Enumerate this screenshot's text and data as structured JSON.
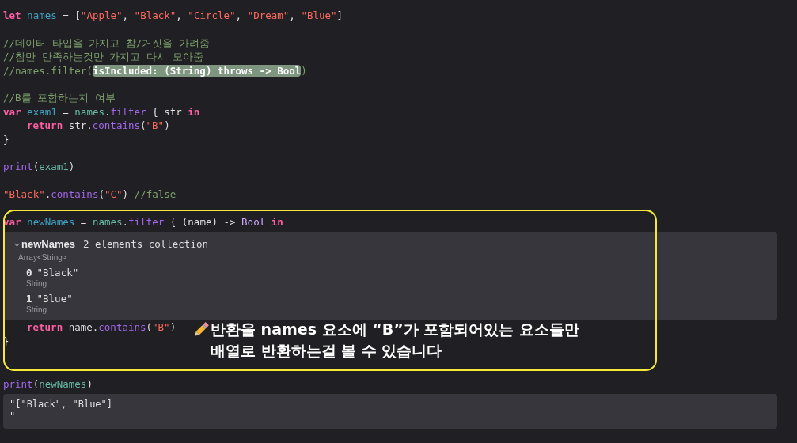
{
  "code_top": [
    {
      "kind": "code",
      "tokens": [
        {
          "kind": "kw",
          "t": "let "
        },
        {
          "kind": "decl",
          "t": "names"
        },
        {
          "kind": "p",
          "t": " = ["
        },
        {
          "kind": "str",
          "t": "\"Apple\""
        },
        {
          "kind": "p",
          "t": ", "
        },
        {
          "kind": "str",
          "t": "\"Black\""
        },
        {
          "kind": "p",
          "t": ", "
        },
        {
          "kind": "str",
          "t": "\"Circle\""
        },
        {
          "kind": "p",
          "t": ", "
        },
        {
          "kind": "str",
          "t": "\"Dream\""
        },
        {
          "kind": "p",
          "t": ", "
        },
        {
          "kind": "str",
          "t": "\"Blue\""
        },
        {
          "kind": "p",
          "t": "]"
        }
      ]
    },
    {
      "kind": "blank"
    },
    {
      "kind": "code",
      "tokens": [
        {
          "kind": "cm",
          "t": "//데이터 타입을 가지고 참/거짓을 가려줌"
        }
      ]
    },
    {
      "kind": "code",
      "tokens": [
        {
          "kind": "cm",
          "t": "//참만 만족하는것만 가지고 다시 모아줌"
        }
      ]
    },
    {
      "kind": "code",
      "tokens": [
        {
          "kind": "cm",
          "t": "//names.filter("
        },
        {
          "kind": "hl",
          "t": "isIncluded: (String) throws -> Bool"
        },
        {
          "kind": "cm",
          "t": ")"
        }
      ]
    },
    {
      "kind": "blank"
    },
    {
      "kind": "code",
      "tokens": [
        {
          "kind": "cm",
          "t": "//B를 포함하는지 여부"
        }
      ]
    },
    {
      "kind": "code",
      "tokens": [
        {
          "kind": "kw",
          "t": "var "
        },
        {
          "kind": "decl",
          "t": "exam1"
        },
        {
          "kind": "p",
          "t": " = "
        },
        {
          "kind": "ref",
          "t": "names"
        },
        {
          "kind": "p",
          "t": "."
        },
        {
          "kind": "fn",
          "t": "filter"
        },
        {
          "kind": "p",
          "t": " { str "
        },
        {
          "kind": "kw",
          "t": "in"
        }
      ]
    },
    {
      "kind": "code",
      "indent": true,
      "tokens": [
        {
          "kind": "kw",
          "t": "return"
        },
        {
          "kind": "p",
          "t": " str."
        },
        {
          "kind": "fn",
          "t": "contains"
        },
        {
          "kind": "p",
          "t": "("
        },
        {
          "kind": "str",
          "t": "\"B\""
        },
        {
          "kind": "p",
          "t": ")"
        }
      ]
    },
    {
      "kind": "code",
      "tokens": [
        {
          "kind": "p",
          "t": "}"
        }
      ]
    },
    {
      "kind": "blank"
    },
    {
      "kind": "code",
      "tokens": [
        {
          "kind": "fn",
          "t": "print"
        },
        {
          "kind": "p",
          "t": "("
        },
        {
          "kind": "ref",
          "t": "exam1"
        },
        {
          "kind": "p",
          "t": ")"
        }
      ]
    },
    {
      "kind": "blank"
    },
    {
      "kind": "code",
      "tokens": [
        {
          "kind": "str",
          "t": "\"Black\""
        },
        {
          "kind": "p",
          "t": "."
        },
        {
          "kind": "fn",
          "t": "contains"
        },
        {
          "kind": "p",
          "t": "("
        },
        {
          "kind": "str",
          "t": "\"C\""
        },
        {
          "kind": "p",
          "t": ") "
        },
        {
          "kind": "cm",
          "t": "//false"
        }
      ]
    },
    {
      "kind": "blank"
    }
  ],
  "focus_line": [
    {
      "kind": "kw",
      "t": "var "
    },
    {
      "kind": "decl",
      "t": "newNames"
    },
    {
      "kind": "p",
      "t": " = "
    },
    {
      "kind": "ref",
      "t": "names"
    },
    {
      "kind": "p",
      "t": "."
    },
    {
      "kind": "fn",
      "t": "filter"
    },
    {
      "kind": "p",
      "t": " { (name) -> "
    },
    {
      "kind": "type",
      "t": "Bool "
    },
    {
      "kind": "kw",
      "t": "in"
    }
  ],
  "inspector": {
    "name": "newNames",
    "summary": "2 elements collection",
    "type": "Array<String>",
    "expanded": true,
    "items": [
      {
        "index": "0",
        "value": "\"Black\"",
        "type": "String"
      },
      {
        "index": "1",
        "value": "\"Blue\"",
        "type": "String"
      }
    ]
  },
  "focus_rest": [
    {
      "kind": "code",
      "indent": true,
      "tokens": [
        {
          "kind": "kw",
          "t": "return"
        },
        {
          "kind": "p",
          "t": " name."
        },
        {
          "kind": "fn",
          "t": "contains"
        },
        {
          "kind": "p",
          "t": "("
        },
        {
          "kind": "str",
          "t": "\"B\""
        },
        {
          "kind": "p",
          "t": ")"
        }
      ]
    },
    {
      "kind": "code",
      "tokens": [
        {
          "kind": "p",
          "t": "}"
        }
      ]
    }
  ],
  "annotation": {
    "lines": [
      "반환을 names 요소에 “B”가 포함되어있는 요소들만",
      "배열로 반환하는걸 볼 수 있습니다"
    ]
  },
  "code_bottom": [
    {
      "kind": "code",
      "tokens": [
        {
          "kind": "fn",
          "t": "print"
        },
        {
          "kind": "p",
          "t": "("
        },
        {
          "kind": "ref",
          "t": "newNames"
        },
        {
          "kind": "p",
          "t": ")"
        }
      ]
    }
  ],
  "output": [
    "\"[\"Black\", \"Blue\"]",
    "\""
  ]
}
